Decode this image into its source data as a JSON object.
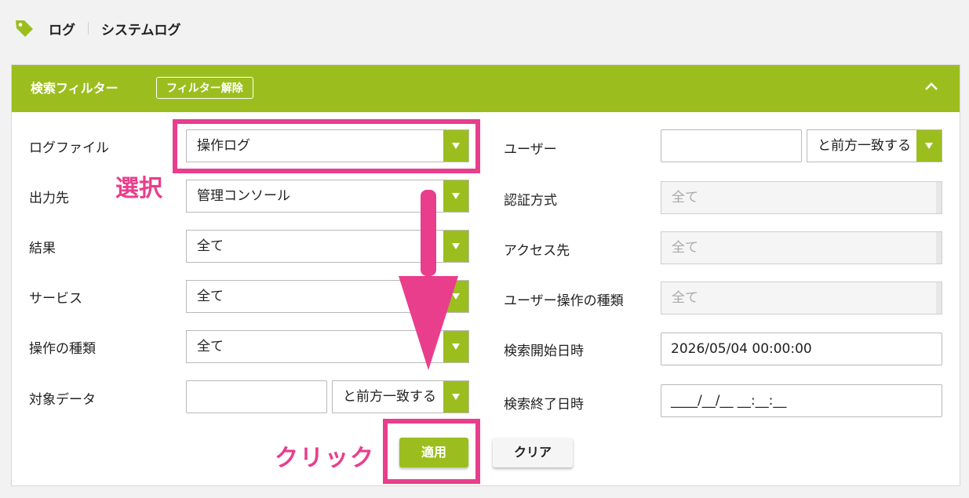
{
  "breadcrumb": {
    "root": "ログ",
    "current": "システムログ",
    "icon": "tag-icon"
  },
  "filter": {
    "title": "検索フィルター",
    "clear_button": "フィルター解除",
    "collapse_icon": "chevron-up-icon",
    "accent_color": "#9bbe1e"
  },
  "left": {
    "log_file": {
      "label": "ログファイル",
      "value": "操作ログ"
    },
    "output": {
      "label": "出力先",
      "value": "管理コンソール"
    },
    "result": {
      "label": "結果",
      "value": "全て"
    },
    "service": {
      "label": "サービス",
      "value": "全て"
    },
    "operation_type": {
      "label": "操作の種類",
      "value": "全て"
    },
    "target_data": {
      "label": "対象データ",
      "input_value": "",
      "match_value": "と前方一致する"
    }
  },
  "right": {
    "user": {
      "label": "ユーザー",
      "input_value": "",
      "match_value": "と前方一致する"
    },
    "auth_method": {
      "label": "認証方式",
      "value": "全て"
    },
    "access_target": {
      "label": "アクセス先",
      "value": "全て"
    },
    "user_operation_type": {
      "label": "ユーザー操作の種類",
      "value": "全て"
    },
    "search_start": {
      "label": "検索開始日時",
      "value": "2026/05/04 00:00:00"
    },
    "search_end": {
      "label": "検索終了日時",
      "value": "____/__/__ __:__:__"
    }
  },
  "buttons": {
    "apply": "適用",
    "clear": "クリア"
  },
  "annotations": {
    "select": "選択",
    "click": "クリック",
    "color": "#e83e8c"
  }
}
